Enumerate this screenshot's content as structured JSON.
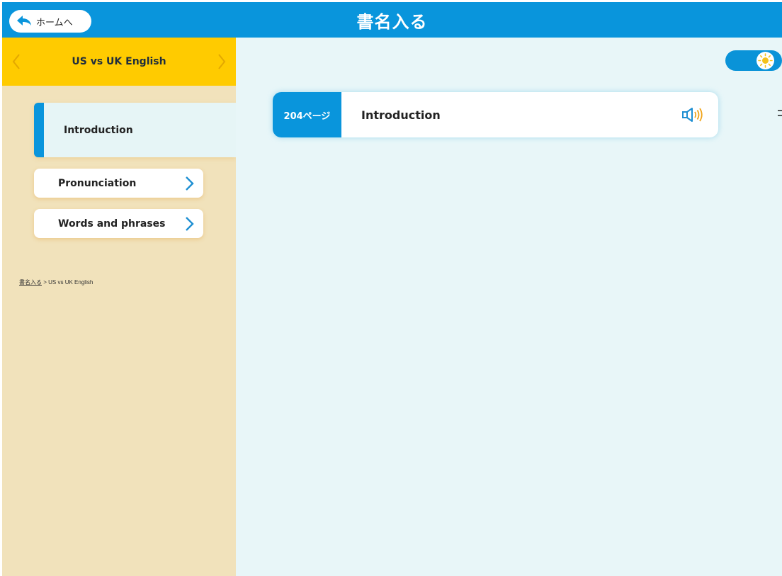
{
  "header": {
    "home_label": "ホームへ",
    "app_title": "書名入る"
  },
  "sidebar": {
    "title": "US vs UK English",
    "items": [
      {
        "label": "Introduction",
        "active": true
      },
      {
        "label": "Pronunciation",
        "active": false
      },
      {
        "label": "Words and phrases",
        "active": false
      }
    ],
    "breadcrumb": {
      "root": "書名入る",
      "separator": ">",
      "current": "US vs UK English"
    }
  },
  "main": {
    "card": {
      "page": "204ページ",
      "title": "Introduction"
    }
  },
  "colors": {
    "primary": "#0995dc",
    "header_yellow": "#ffcb00",
    "sidebar_bg": "#f1e2bb",
    "main_bg": "#e8f6f8",
    "sun": "#f4c21b"
  }
}
